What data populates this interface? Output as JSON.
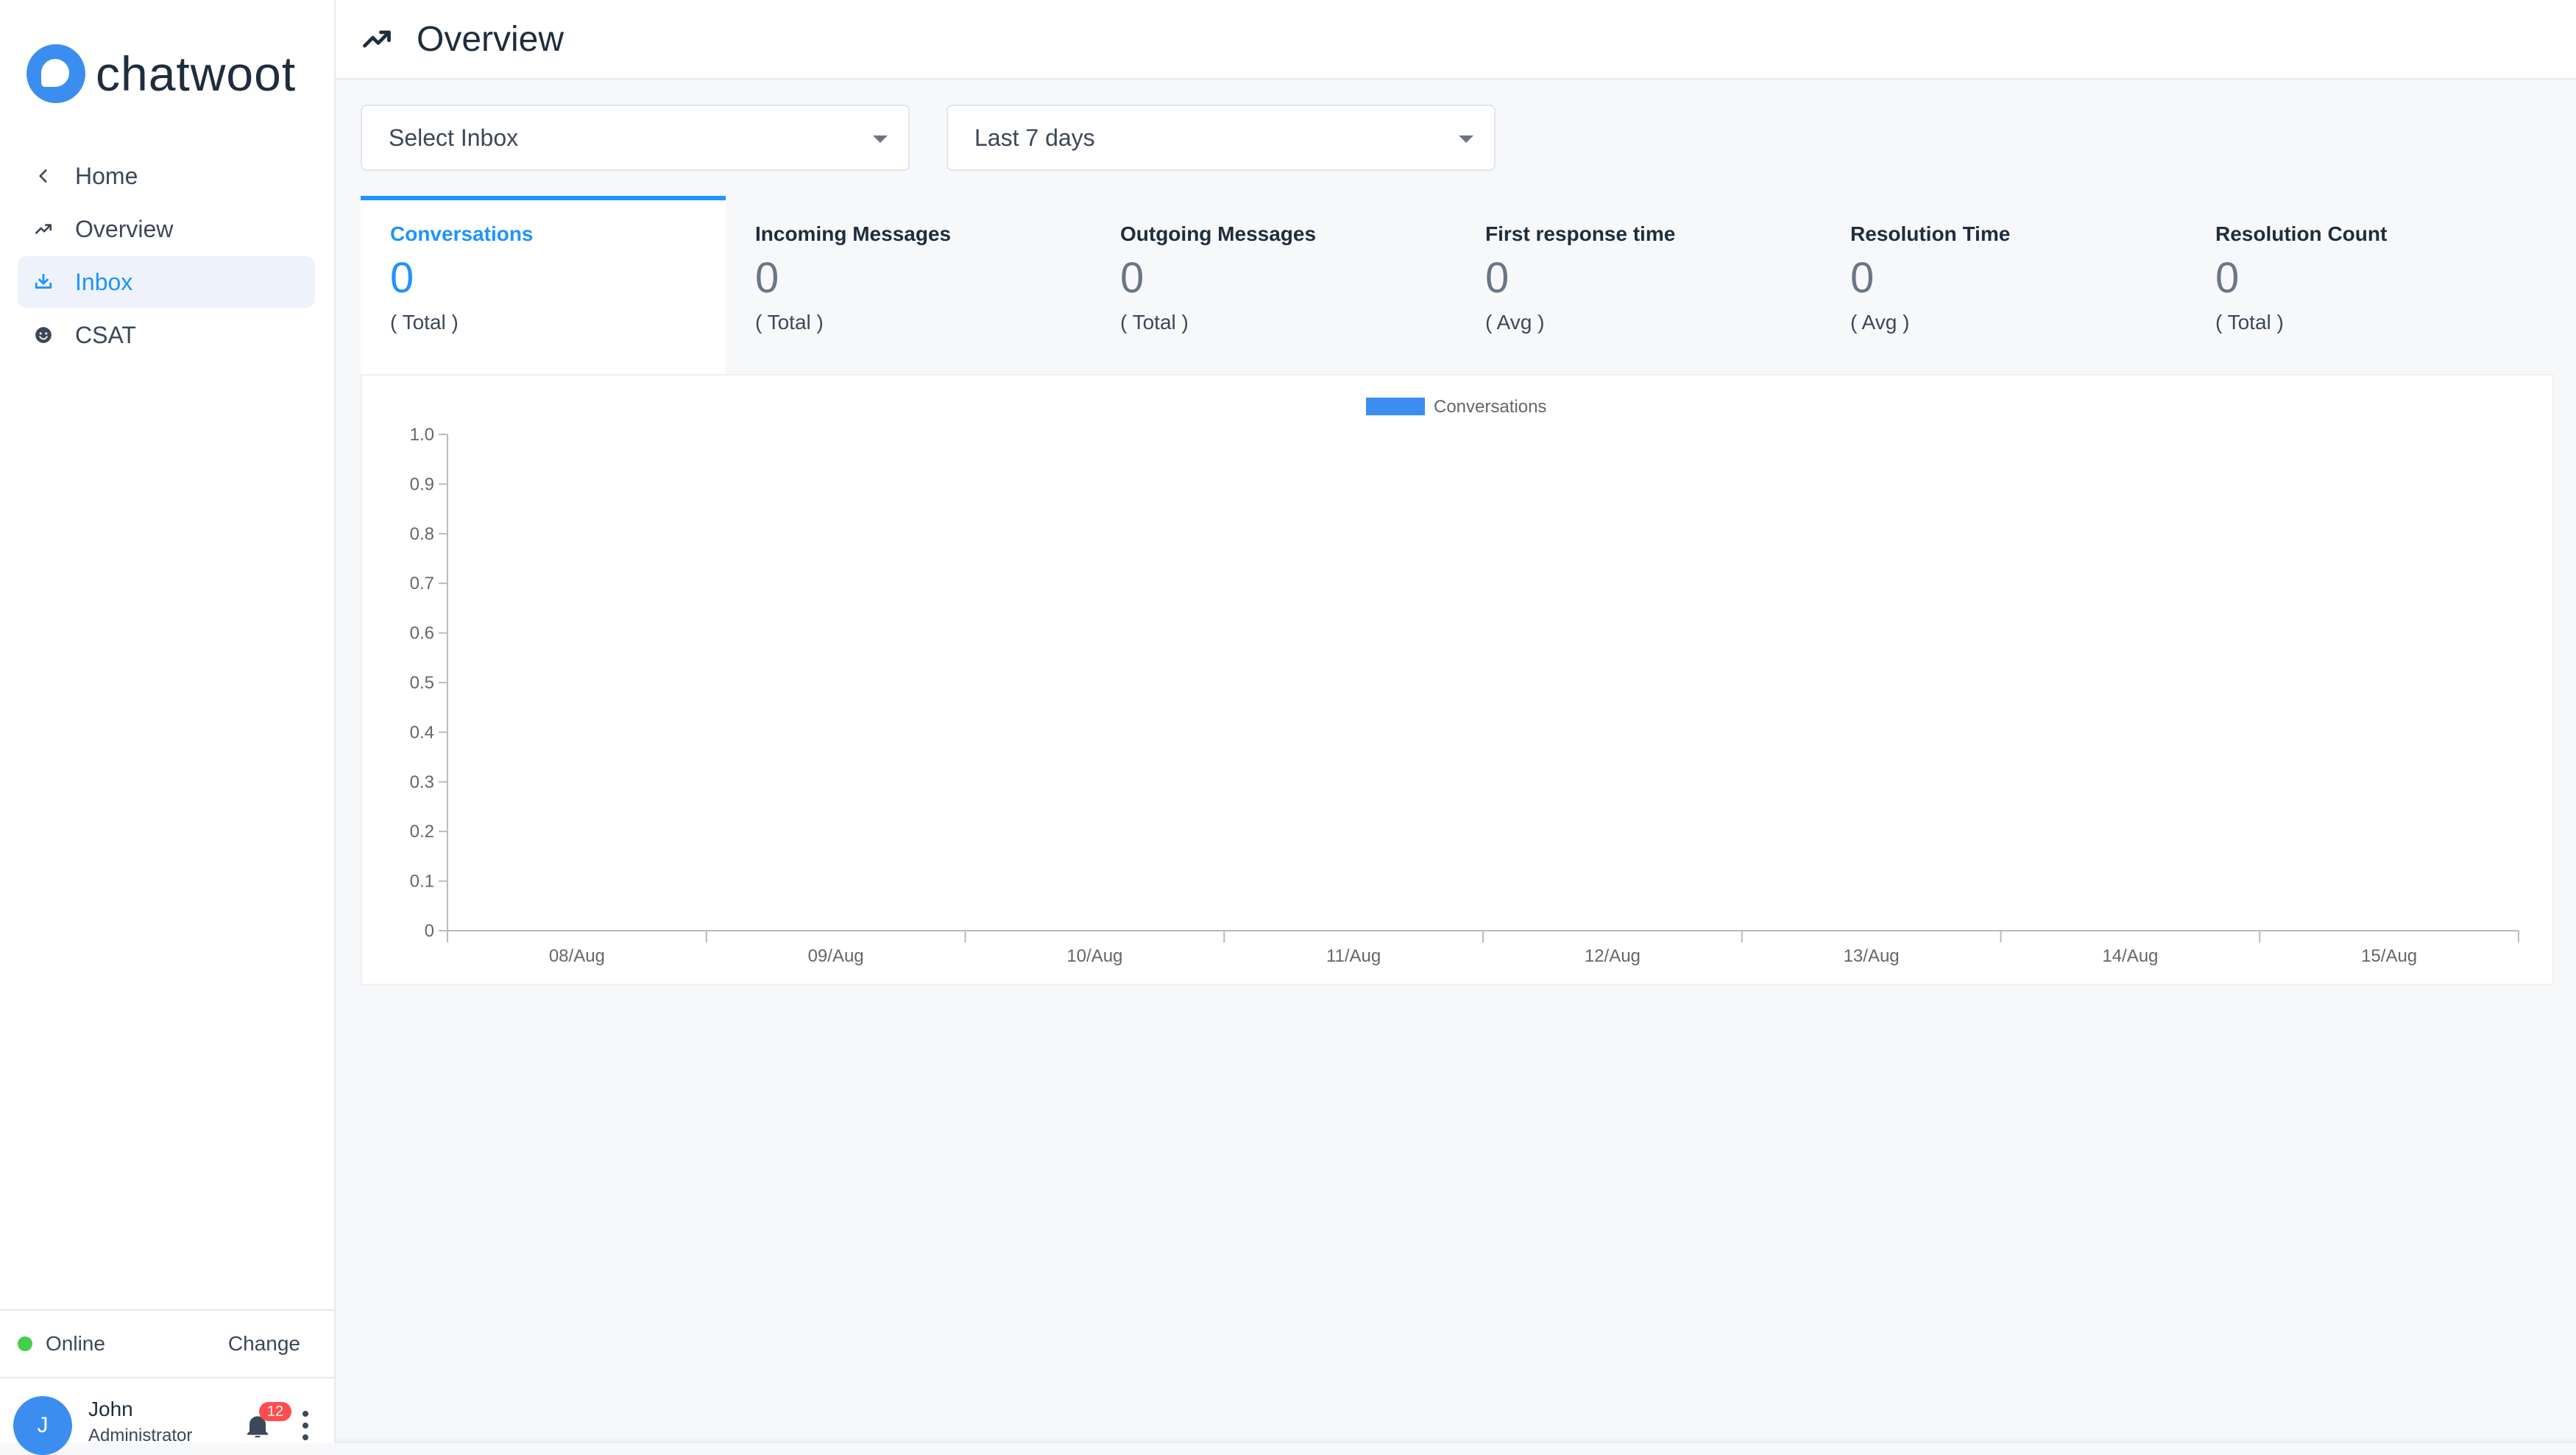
{
  "brand": {
    "name": "chatwoot"
  },
  "sidebar": {
    "items": [
      {
        "label": "Home",
        "icon": "chevron-left-icon"
      },
      {
        "label": "Overview",
        "icon": "trending-icon"
      },
      {
        "label": "Inbox",
        "icon": "inbox-icon",
        "active": true
      },
      {
        "label": "CSAT",
        "icon": "smile-icon"
      }
    ]
  },
  "status": {
    "label": "Online",
    "change_label": "Change",
    "color": "#44ce4b"
  },
  "user": {
    "initial": "J",
    "name": "John",
    "role": "Administrator",
    "notifications": "12"
  },
  "header": {
    "title": "Overview",
    "icon": "trending-icon"
  },
  "filters": {
    "inbox": {
      "value": "Select Inbox"
    },
    "range": {
      "value": "Last 7 days"
    }
  },
  "metrics": [
    {
      "title": "Conversations",
      "value": "0",
      "desc": "( Total )"
    },
    {
      "title": "Incoming Messages",
      "value": "0",
      "desc": "( Total )"
    },
    {
      "title": "Outgoing Messages",
      "value": "0",
      "desc": "( Total )"
    },
    {
      "title": "First response time",
      "value": "0",
      "desc": "( Avg )"
    },
    {
      "title": "Resolution Time",
      "value": "0",
      "desc": "( Avg )"
    },
    {
      "title": "Resolution Count",
      "value": "0",
      "desc": "( Total )"
    }
  ],
  "colors": {
    "accent": "#1f93ff",
    "series": "#3b8ef0"
  },
  "chart_data": {
    "type": "bar",
    "categories": [
      "08/Aug",
      "09/Aug",
      "10/Aug",
      "11/Aug",
      "12/Aug",
      "13/Aug",
      "14/Aug",
      "15/Aug"
    ],
    "series": [
      {
        "name": "Conversations",
        "values": [
          0,
          0,
          0,
          0,
          0,
          0,
          0,
          0
        ]
      }
    ],
    "yticks": [
      "0",
      "0.1",
      "0.2",
      "0.3",
      "0.4",
      "0.5",
      "0.6",
      "0.7",
      "0.8",
      "0.9",
      "1.0"
    ],
    "ylim": [
      0,
      1.0
    ],
    "legend": "top-center",
    "grid": false
  }
}
